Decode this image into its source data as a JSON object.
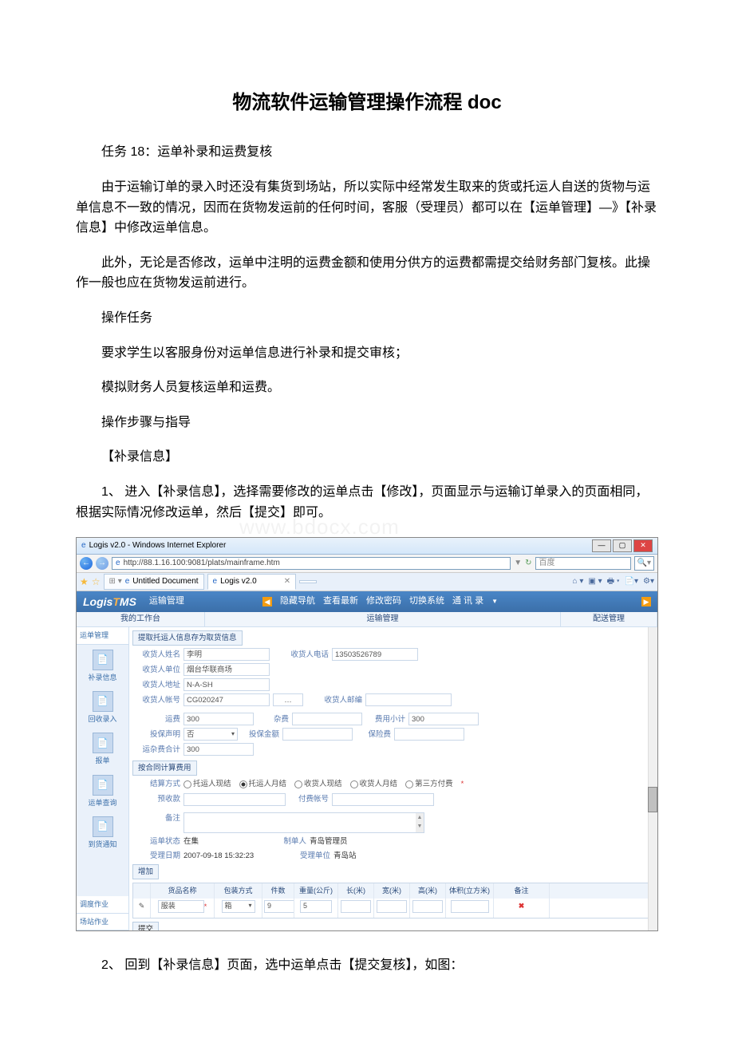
{
  "doc": {
    "title": "物流软件运输管理操作流程 doc",
    "p_task": "任务 18：运单补录和运费复核",
    "p1": "由于运输订单的录入时还没有集货到场站，所以实际中经常发生取来的货或托运人自送的货物与运单信息不一致的情况，因而在货物发运前的任何时间，客服（受理员）都可以在【运单管理】—》【补录信息】中修改运单信息。",
    "p2": "此外，无论是否修改，运单中注明的运费金额和使用分供方的运费都需提交给财务部门复核。此操作一般也应在货物发运前进行。",
    "p3": "操作任务",
    "p4": "要求学生以客服身份对运单信息进行补录和提交审核；",
    "p5": "模拟财务人员复核运单和运费。",
    "p6": "操作步骤与指导",
    "p7": "【补录信息】",
    "p8": "1、 进入【补录信息】，选择需要修改的运单点击【修改】，页面显示与运输订单录入的页面相同，根据实际情况修改运单，然后【提交】即可。",
    "p9": "2、 回到【补录信息】页面，选中运单点击【提交复核】，如图：",
    "watermark": "www.bdocx.com"
  },
  "ie": {
    "window_title": "Logis v2.0 - Windows Internet Explorer",
    "url": "http://88.1.16.100:9081/plats/mainframe.htm",
    "search_hint": "百度",
    "tab1": "Untitled Document",
    "tab2": "Logis v2.0",
    "nav_back": "←",
    "nav_fwd": "→"
  },
  "app": {
    "logo_prefix": "Logis",
    "logo_t": "T",
    "logo_suffix": "MS",
    "module": "运输管理",
    "hide_nav": "隐藏导航",
    "refresh": "查看最新",
    "change_pw": "修改密码",
    "switch_sys": "切换系统",
    "contact": "通 讯 录",
    "subcol1": "我的工作台",
    "subcol2": "运输管理",
    "subcol3": "配送管理"
  },
  "sidebar": {
    "section1": "运单管理",
    "items": [
      "补录信息",
      "回收录入",
      "报单",
      "运单查询",
      "到货通知"
    ],
    "section2": "调度作业",
    "section3": "场站作业"
  },
  "form": {
    "fetch_btn": "提取托运人信息存为取货信息",
    "consignee_name_lbl": "收货人姓名",
    "consignee_name": "李明",
    "consignee_phone_lbl": "收货人电话",
    "consignee_phone": "13503526789",
    "consignee_company_lbl": "收货人单位",
    "consignee_company": "烟台华联商场",
    "consignee_addr_lbl": "收货人地址",
    "consignee_addr": "N-A-SH",
    "consignee_acct_lbl": "收货人帐号",
    "consignee_acct": "CG020247",
    "consignee_zip_lbl": "收货人邮编",
    "freight_lbl": "运费",
    "freight": "300",
    "misc_lbl": "杂费",
    "subtotal_lbl": "费用小计",
    "subtotal": "300",
    "insure_decl_lbl": "投保声明",
    "insure_decl": "否",
    "insure_amt_lbl": "投保金额",
    "insure_fee_lbl": "保险费",
    "fee_total_lbl": "运杂费合计",
    "fee_total": "300",
    "contract_fee_btn": "按合同计算费用",
    "settle_lbl": "结算方式",
    "settle_opts": [
      "托运人现结",
      "托运人月结",
      "收货人现结",
      "收货人月结",
      "第三方付费"
    ],
    "settle_checked": 1,
    "prepay_lbl": "预收款",
    "pay_acct_lbl": "付费帐号",
    "remark_lbl": "备注",
    "status_lbl": "运单状态",
    "status": "在集",
    "creator_lbl": "制单人",
    "creator": "青岛管理员",
    "accept_date_lbl": "受理日期",
    "accept_date": "2007-09-18 15:32:23",
    "accept_unit_lbl": "受理单位",
    "accept_unit": "青岛站",
    "add_btn": "增加",
    "submit_btn": "提交"
  },
  "goods": {
    "headers": [
      "",
      "货品名称",
      "包装方式",
      "件数",
      "重量(公斤)",
      "长(米)",
      "宽(米)",
      "高(米)",
      "体积(立方米)",
      "备注"
    ],
    "row": {
      "name": "服装",
      "pack": "箱",
      "qty": "9",
      "weight": "5"
    }
  }
}
